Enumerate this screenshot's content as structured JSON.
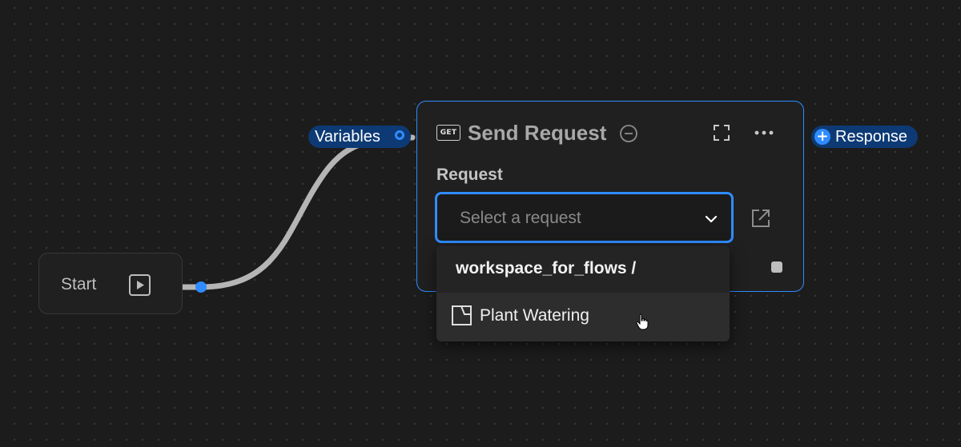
{
  "start_node": {
    "label": "Start",
    "icon": "play-icon"
  },
  "variables_pill": {
    "label": "Variables",
    "icon": "connector-dot-icon"
  },
  "response_pill": {
    "label": "Response",
    "icon": "plus-icon"
  },
  "request_node": {
    "method_badge": "GET",
    "title": "Send Request",
    "section_label": "Request",
    "select": {
      "placeholder": "Select a request"
    },
    "icons": [
      "minus-circle-icon",
      "expand-icon",
      "more-icon",
      "open-link-icon",
      "stop-icon",
      "chevron-down-icon"
    ]
  },
  "dropdown": {
    "header": "workspace_for_flows /",
    "items": [
      {
        "label": "Plant Watering",
        "icon": "file-icon"
      }
    ]
  },
  "colors": {
    "accent": "#2f8cff",
    "pill_bg": "#0d3a75",
    "canvas_bg": "#1c1c1c",
    "node_bg": "#202020"
  }
}
